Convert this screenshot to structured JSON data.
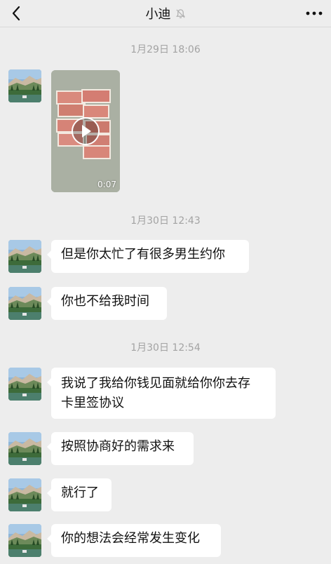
{
  "header": {
    "back_icon": "chevron-left-icon",
    "title": "小迪",
    "mute_icon": "bell-off-icon",
    "more_icon": "ellipsis-icon"
  },
  "messages": {
    "time_1": "1月29日 18:06",
    "video_duration": "0:07",
    "time_2": "1月30日 12:43",
    "msg_1": "但是你太忙了有很多男生约你",
    "msg_2": "你也不给我时间",
    "time_3": "1月30日 12:54",
    "msg_3_line1": "我说了我给你钱见面就给你你去存",
    "msg_3_line2": "卡里签协议",
    "msg_4": "按照协商好的需求来",
    "msg_5": "就行了",
    "msg_6": "你的想法会经常发生变化"
  },
  "colors": {
    "background": "#ededed",
    "bubble": "#ffffff",
    "timestamp": "#a3a3a3"
  }
}
